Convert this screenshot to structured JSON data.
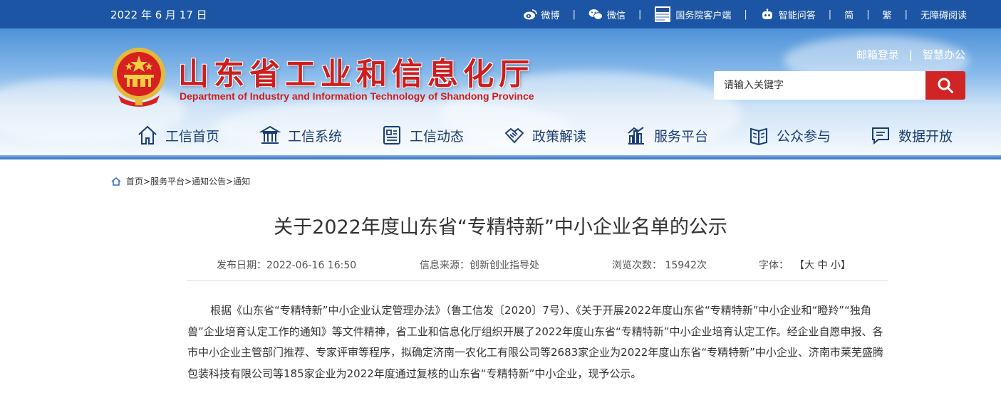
{
  "topbar": {
    "date": "2022 年 6 月 17 日",
    "weibo": "微博",
    "weixin": "微信",
    "client": "国务院客户端",
    "qa": "智能问答",
    "simplified": "简",
    "traditional": "繁",
    "accessible": "无障碍阅读"
  },
  "header": {
    "title_cn": "山东省工业和信息化厅",
    "title_en": "Department of Industry and Information Technology of Shandong Province",
    "mail_login": "邮箱登录",
    "smart_office": "智慧办公",
    "search_placeholder": "请输入关键字"
  },
  "nav": [
    {
      "label": "工信首页",
      "icon": "home-icon"
    },
    {
      "label": "工信系统",
      "icon": "building-icon"
    },
    {
      "label": "工信动态",
      "icon": "news-icon"
    },
    {
      "label": "政策解读",
      "icon": "handshake-icon"
    },
    {
      "label": "服务平台",
      "icon": "bar-chart-icon"
    },
    {
      "label": "公众参与",
      "icon": "book-icon"
    },
    {
      "label": "数据开放",
      "icon": "chat-icon"
    }
  ],
  "breadcrumb": {
    "home": "首页",
    "service": "服务平台",
    "notice": "通知公告",
    "current": "通知"
  },
  "article": {
    "title": "关于2022年度山东省“专精特新”中小企业名单的公示",
    "publish_label": "发布日期：2022-06-16 16:50",
    "source_label": "信息来源：创新创业指导处",
    "views_label": "浏览次数：  15942次",
    "font_label": "字体：",
    "font_sizes": "【大 中 小】",
    "body": "根据《山东省“专精特新”中小企业认定管理办法》（鲁工信发〔2020〕7号）、《关于开展2022年度山东省“专精特新”中小企业和“瞪羚”“独角兽”企业培育认定工作的通知》等文件精神，省工业和信息化厅组织开展了2022年度山东省“专精特新”中小企业培育认定工作。经企业自愿申报、各市中小企业主管部门推荐、专家评审等程序，拟确定济南一农化工有限公司等2683家企业为2022年度山东省“专精特新”中小企业、济南市莱芜盛腾包装科技有限公司等185家企业为2022年度通过复核的山东省“专精特新”中小企业，现予公示。"
  },
  "colors": {
    "topbar": "#1c55a4",
    "title_red": "#cc1e1e",
    "search_button": "#d12424",
    "nav_text": "#1a3d73"
  }
}
